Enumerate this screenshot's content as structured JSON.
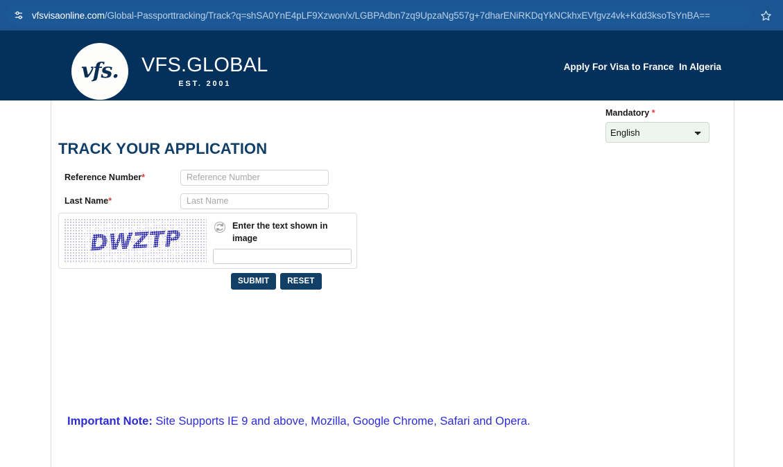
{
  "browser": {
    "url_host": "vfsvisaonline.com",
    "url_path": "/Global-Passporttracking/Track?q=shSA0YnE4pLF9Xzwon/x/LGBPAdbn7zq9UpzaNg557g+7dharENiRKDqYkNCkhxEVfgvz4vk+Kdd3ksoTsYnBA==",
    "site_settings_icon": "tune-sliders-icon",
    "bookmark_icon": "star-icon",
    "chrome_bar_color": "#1b5693"
  },
  "header": {
    "logo_mark_text": "vfs.",
    "brand": "VFS.GLOBAL",
    "established": "EST. 2001",
    "right_text": "Apply For Visa to France  In Algeria",
    "background_color": "#04305c"
  },
  "language": {
    "mandatory_label": "Mandatory",
    "required_marker": "*",
    "selected": "English",
    "options": [
      "English"
    ]
  },
  "main": {
    "page_title": "TRACK YOUR APPLICATION",
    "title_color": "#113f68",
    "fields": [
      {
        "label": "Reference Number",
        "required_marker": "*",
        "placeholder": "Reference Number",
        "value": ""
      },
      {
        "label": "Last Name",
        "required_marker": "*",
        "placeholder": "Last Name",
        "value": ""
      }
    ],
    "captcha": {
      "image_text": "DWZTP",
      "refresh_icon": "refresh-icon",
      "prompt": "Enter the text shown in image",
      "input_placeholder": "",
      "input_value": ""
    },
    "buttons": {
      "submit_label": "SUBMIT",
      "reset_label": "RESET",
      "button_color": "#123f66"
    }
  },
  "footer_note": {
    "label": "Important Note:",
    "text": " Site Supports IE 9 and above, Mozilla, Google Chrome, Safari and Opera.",
    "color": "#2c2cd8"
  }
}
